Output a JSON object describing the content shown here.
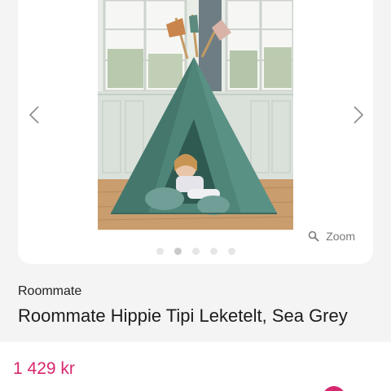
{
  "gallery": {
    "zoom_label": "Zoom",
    "dots_total": 5,
    "dots_active_index": 1,
    "icons": {
      "prev": "chevron-left-icon",
      "next": "chevron-right-icon",
      "zoom": "magnifier-icon"
    }
  },
  "product": {
    "brand": "Roommate",
    "title": "Roommate Hippie Tipi Leketelt, Sea Grey",
    "price": "1 429 kr"
  },
  "colors": {
    "accent": "#d6286e",
    "tent": "#4f8579",
    "background": "#f4f4f4"
  }
}
